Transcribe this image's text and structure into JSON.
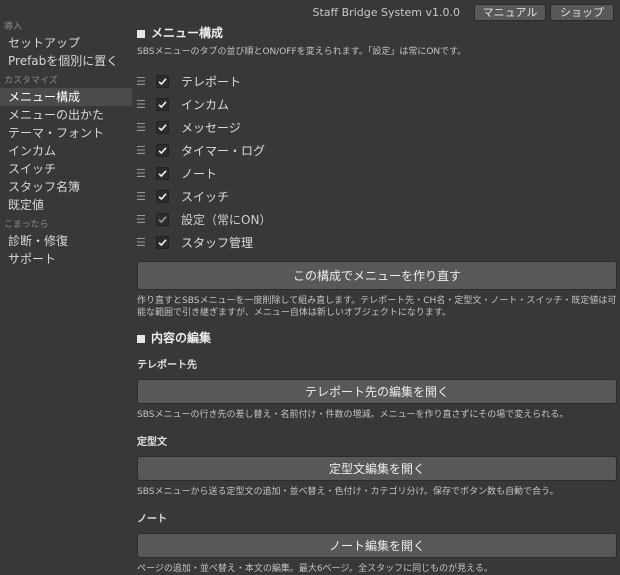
{
  "header": {
    "app_title": "Staff Bridge System v1.0.0",
    "manual_label": "マニュアル",
    "shop_label": "ショップ"
  },
  "sidebar": {
    "categories": [
      {
        "label": "導入",
        "items": [
          "セットアップ",
          "Prefabを個別に置く"
        ]
      },
      {
        "label": "カスタマイズ",
        "items": [
          "メニュー構成",
          "メニューの出かた",
          "テーマ・フォント",
          "インカム",
          "スイッチ",
          "スタッフ名簿",
          "既定値"
        ]
      },
      {
        "label": "こまったら",
        "items": [
          "診断・修復",
          "サポート"
        ]
      }
    ],
    "active_item": "メニュー構成"
  },
  "menu_section": {
    "title": "メニュー構成",
    "description": "SBSメニューのタブの並び順とON/OFFを変えられます。「設定」は常にONです。",
    "items": [
      {
        "label": "テレポート",
        "checked": true,
        "locked": false
      },
      {
        "label": "インカム",
        "checked": true,
        "locked": false
      },
      {
        "label": "メッセージ",
        "checked": true,
        "locked": false
      },
      {
        "label": "タイマー・ログ",
        "checked": true,
        "locked": false
      },
      {
        "label": "ノート",
        "checked": true,
        "locked": false
      },
      {
        "label": "スイッチ",
        "checked": true,
        "locked": false
      },
      {
        "label": "設定（常にON）",
        "checked": true,
        "locked": true
      },
      {
        "label": "スタッフ管理",
        "checked": true,
        "locked": false
      }
    ],
    "rebuild_button": "この構成でメニューを作り直す",
    "rebuild_note": "作り直すとSBSメニューを一度削除して組み直します。テレポート先・CH名・定型文・ノート・スイッチ・既定値は可能な範囲で引き継ぎますが、メニュー自体は新しいオブジェクトになります。"
  },
  "content_section": {
    "title": "内容の編集",
    "groups": [
      {
        "title": "テレポート先",
        "button": "テレポート先の編集を開く",
        "note": "SBSメニューの行き先の差し替え・名前付け・件数の増減。メニューを作り直さずにその場で変えられる。"
      },
      {
        "title": "定型文",
        "button": "定型文編集を開く",
        "note": "SBSメニューから送る定型文の追加・並べ替え・色付け・カテゴリ分け。保存でボタン数も自動で合う。"
      },
      {
        "title": "ノート",
        "button": "ノート編集を開く",
        "note": "ページの追加・並べ替え・本文の編集。最大6ページ。全スタッフに同じものが見える。"
      }
    ]
  },
  "colors": {
    "background": "#383838",
    "active_sidebar": "#4b4b4b",
    "button": "#585858",
    "checkbox": "#2c2c2c"
  }
}
